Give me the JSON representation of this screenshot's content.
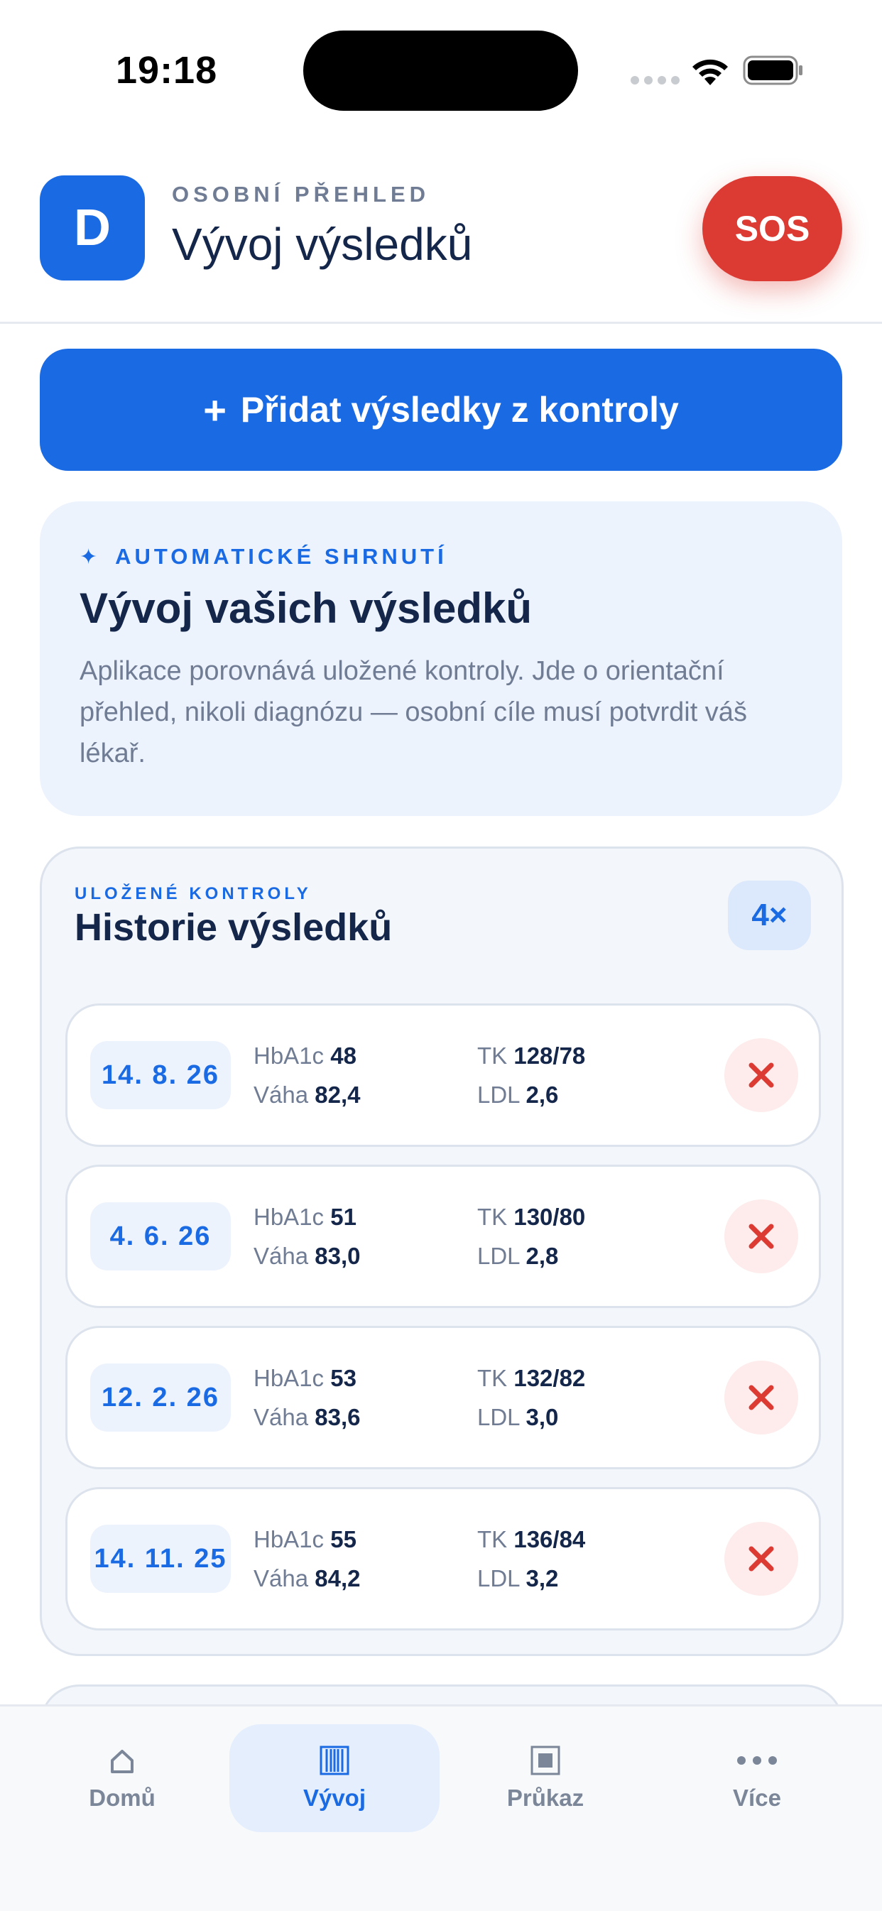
{
  "status_bar": {
    "time": "19:18"
  },
  "header": {
    "avatar_letter": "D",
    "overline": "OSOBNÍ PŘEHLED",
    "title": "Vývoj výsledků",
    "sos_label": "SOS"
  },
  "add_button": {
    "icon": "plus-icon",
    "label": "Přidat výsledky z kontroly"
  },
  "summary": {
    "overline": "AUTOMATICKÉ SHRNUTÍ",
    "title": "Vývoj vašich výsledků",
    "text": "Aplikace porovnává uložené kontroly. Jde o orientační přehled, nikoli diagnózu — osobní cíle musí potvrdit váš lékař."
  },
  "history": {
    "overline": "ULOŽENÉ KONTROLY",
    "title": "Historie výsledků",
    "count": "4×",
    "rows": [
      {
        "date": "14. 8. 26",
        "hba1c_label": "HbA1c",
        "hba1c": "48",
        "tk_label": "TK",
        "tk": "128/78",
        "weight_label": "Váha",
        "weight": "82,4",
        "ldl_label": "LDL",
        "ldl": "2,6"
      },
      {
        "date": "4. 6. 26",
        "hba1c_label": "HbA1c",
        "hba1c": "51",
        "tk_label": "TK",
        "tk": "130/80",
        "weight_label": "Váha",
        "weight": "83,0",
        "ldl_label": "LDL",
        "ldl": "2,8"
      },
      {
        "date": "12. 2. 26",
        "hba1c_label": "HbA1c",
        "hba1c": "53",
        "tk_label": "TK",
        "tk": "132/82",
        "weight_label": "Váha",
        "weight": "83,6",
        "ldl_label": "LDL",
        "ldl": "3,0"
      },
      {
        "date": "14. 11. 25",
        "hba1c_label": "HbA1c",
        "hba1c": "55",
        "tk_label": "TK",
        "tk": "136/84",
        "weight_label": "Váha",
        "weight": "84,2",
        "ldl_label": "LDL",
        "ldl": "3,2"
      }
    ]
  },
  "nav": {
    "items": [
      {
        "label": "Domů",
        "icon": "home-icon"
      },
      {
        "label": "Vývoj",
        "icon": "chart-icon",
        "active": true
      },
      {
        "label": "Průkaz",
        "icon": "card-icon"
      },
      {
        "label": "Více",
        "icon": "more-icon"
      }
    ]
  },
  "colors": {
    "accent": "#1a6ae3",
    "danger": "#dc3b34",
    "text": "#14264a",
    "muted": "#6f7c93"
  }
}
